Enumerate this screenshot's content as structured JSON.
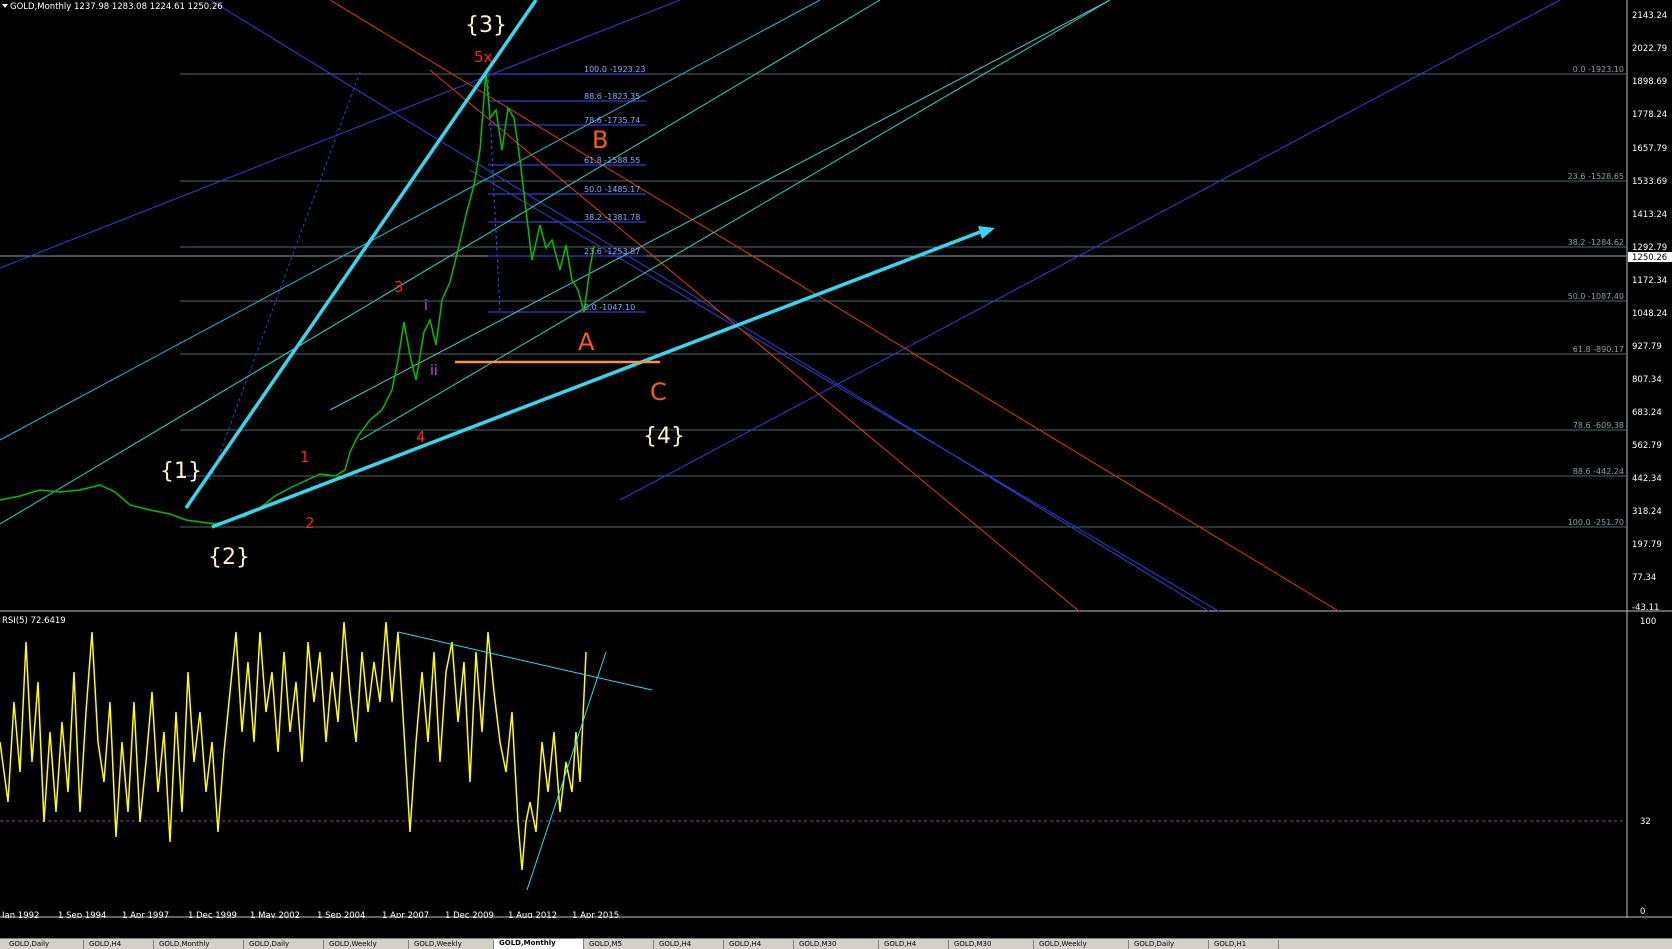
{
  "chart_header": {
    "symbol": "GOLD,Monthly",
    "ohlc": "1237.98 1283.08 1224.61 1250.26"
  },
  "colors": {
    "background": "#000000",
    "price_line": "#00c000",
    "rsi_line": "#ffff00",
    "cyan_trend": "#33d8f0",
    "fib": "#3a4cff",
    "red_channel": "#e03a10",
    "wave_label_red": "#ff2020",
    "wave_label_orange": "#ff5a10",
    "wave_label_white": "#fff2c8",
    "wave_label_magenta": "#d040ff"
  },
  "price_axis": {
    "labels": [
      "2143.24",
      "2022.79",
      "1898.69",
      "1778.24",
      "1657.79",
      "1533.69",
      "1413.24",
      "1292.79",
      "1250.26",
      "1172.34",
      "1048.24",
      "927.79",
      "807.34",
      "683.24",
      "562.79",
      "442.34",
      "318.24",
      "197.79",
      "77.34",
      "-43.11"
    ],
    "current": "1250.26"
  },
  "rsi": {
    "title": "RSI(5) 72.6419",
    "level_labels": [
      "100",
      "32",
      "0"
    ]
  },
  "time_axis": {
    "labels": [
      "Jan 1992",
      "1 Sep 1994",
      "1 Apr 1997",
      "1 Dec 1999",
      "1 May 2002",
      "1 Sep 2004",
      "1 Apr 2007",
      "1 Dec 2009",
      "1 Aug 2012",
      "1 Apr 2015"
    ]
  },
  "fib_inner": [
    {
      "text": "100.0 -1923.23"
    },
    {
      "text": "88.6 -1823.35"
    },
    {
      "text": "78.6 -1735.74"
    },
    {
      "text": "61.8 -1588.55"
    },
    {
      "text": "50.0 -1485.17"
    },
    {
      "text": "38.2 -1381.78"
    },
    {
      "text": "23.6 -1253.87"
    },
    {
      "text": "0.0 -1047.10"
    }
  ],
  "fib_outer": [
    {
      "text": "0.0 -1923.10"
    },
    {
      "text": "23.6 -1528.65"
    },
    {
      "text": "38.2 -1284.62"
    },
    {
      "text": "50.0 -1087.40"
    },
    {
      "text": "61.8 -890.17"
    },
    {
      "text": "78.6 -609.38"
    },
    {
      "text": "88.6 -442.24"
    },
    {
      "text": "100.0 -251.70"
    }
  ],
  "wave_labels": {
    "w1": "{1}",
    "w2": "{2}",
    "w3": "{3}",
    "w4": "{4}",
    "s1": "1",
    "s2": "2",
    "s3": "3",
    "s4": "4",
    "s5": "5x",
    "i": "i",
    "ii": "ii",
    "A": "A",
    "B": "B",
    "C": "C"
  },
  "tabs": [
    "GOLD,Daily",
    "GOLD,H4",
    "GOLD,Monthly",
    "GOLD,Daily",
    "GOLD,Weekly",
    "GOLD,Weekly",
    "GOLD,Monthly",
    "GOLD,M5",
    "GOLD,H4",
    "GOLD,H4",
    "GOLD,M30",
    "GOLD,H4",
    "GOLD,M30",
    "GOLD,Weekly",
    "GOLD,Daily",
    "GOLD,H1"
  ],
  "active_tab": 6
}
